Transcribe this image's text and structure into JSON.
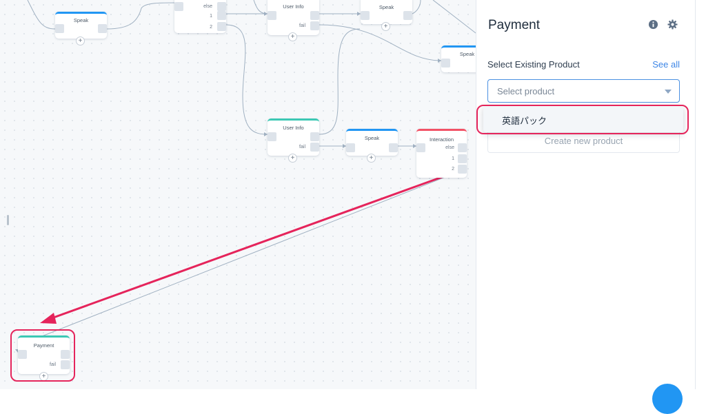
{
  "canvas": {
    "nodes": {
      "speak1": {
        "title": "Speak"
      },
      "menu": {
        "labels": [
          "else",
          "1",
          "2"
        ]
      },
      "userinfo1": {
        "title": "User Info",
        "fail": "fail"
      },
      "speak2": {
        "title": "Speak"
      },
      "speak3": {
        "title": "Speak"
      },
      "userinfo2": {
        "title": "User Info",
        "fail": "fail"
      },
      "speak4": {
        "title": "Speak"
      },
      "interaction": {
        "title": "Interaction",
        "labels": [
          "else",
          "1",
          "2"
        ]
      },
      "payment": {
        "title": "Payment",
        "fail": "fail"
      }
    },
    "add_symbol": "+"
  },
  "panel": {
    "title": "Payment",
    "info_icon": "info-circle-icon",
    "settings_icon": "gear-icon",
    "section_label": "Select Existing Product",
    "see_all": "See all",
    "select_placeholder": "Select product",
    "dropdown_option": "英語パック",
    "create_button": "Create new product"
  },
  "colors": {
    "blue": "#2196f3",
    "teal": "#3cc8b4",
    "red": "#f25266",
    "highlight": "#e5245b",
    "link": "#3d86e6"
  }
}
